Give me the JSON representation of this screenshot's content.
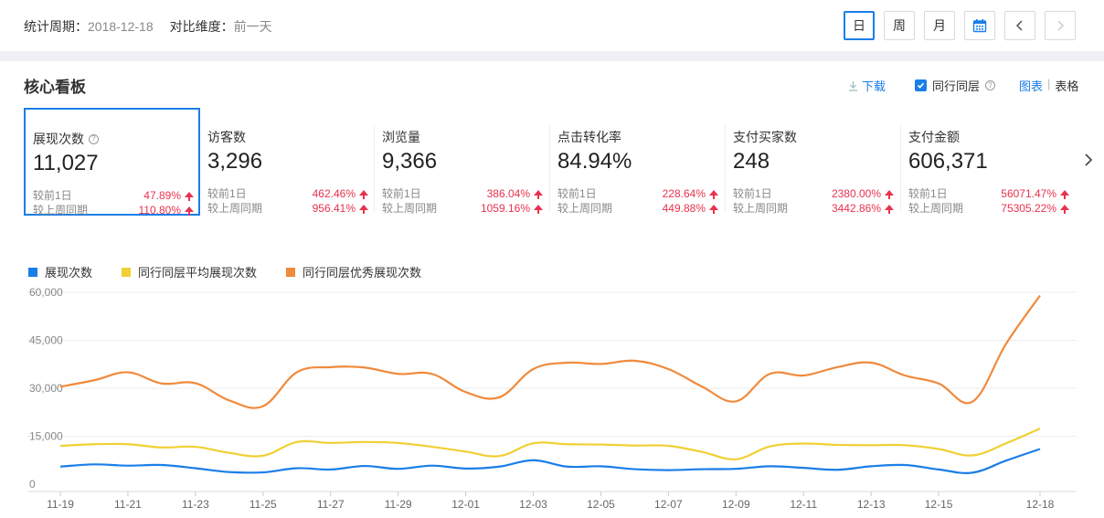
{
  "filters": {
    "period_label": "统计周期：",
    "period_value": "2018-12-18",
    "compare_label": "对比维度：",
    "compare_value": "前一天"
  },
  "range_buttons": [
    "日",
    "周",
    "月"
  ],
  "active_range": "日",
  "section": {
    "title": "核心看板",
    "download_label": "下载",
    "peer_label": "同行同层",
    "view_chart": "图表",
    "view_table": "表格"
  },
  "metrics": [
    {
      "label": "展现次数",
      "value": "11,027",
      "day_label": "较前1日",
      "day_change": "47.89%",
      "week_label": "较上周同期",
      "week_change": "110.80%"
    },
    {
      "label": "访客数",
      "value": "3,296",
      "day_label": "较前1日",
      "day_change": "462.46%",
      "week_label": "较上周同期",
      "week_change": "956.41%"
    },
    {
      "label": "浏览量",
      "value": "9,366",
      "day_label": "较前1日",
      "day_change": "386.04%",
      "week_label": "较上周同期",
      "week_change": "1059.16%"
    },
    {
      "label": "点击转化率",
      "value": "84.94%",
      "day_label": "较前1日",
      "day_change": "228.64%",
      "week_label": "较上周同期",
      "week_change": "449.88%"
    },
    {
      "label": "支付买家数",
      "value": "248",
      "day_label": "较前1日",
      "day_change": "2380.00%",
      "week_label": "较上周同期",
      "week_change": "3442.86%"
    },
    {
      "label": "支付金额",
      "value": "606,371",
      "day_label": "较前1日",
      "day_change": "56071.47%",
      "week_label": "较上周同期",
      "week_change": "75305.22%"
    }
  ],
  "colors": {
    "accent": "#1a7ee8",
    "up": "#e8324e",
    "series_blue": "#1a7ee8",
    "series_yellow": "#f0d034",
    "series_orange": "#f08a3c"
  },
  "chart_data": {
    "type": "line",
    "x": [
      "11-19",
      "11-20",
      "11-21",
      "11-22",
      "11-23",
      "11-24",
      "11-25",
      "11-26",
      "11-27",
      "11-28",
      "11-29",
      "11-30",
      "12-01",
      "12-02",
      "12-03",
      "12-04",
      "12-05",
      "12-06",
      "12-07",
      "12-08",
      "12-09",
      "12-10",
      "12-11",
      "12-12",
      "12-13",
      "12-14",
      "12-15",
      "12-16",
      "12-17",
      "12-18"
    ],
    "x_tick_labels": [
      "11-19",
      "11-21",
      "11-23",
      "11-25",
      "11-27",
      "11-29",
      "12-01",
      "12-03",
      "12-05",
      "12-07",
      "12-09",
      "12-11",
      "12-13",
      "12-15",
      "12-18"
    ],
    "y_tick_labels": [
      "0",
      "15,000",
      "30,000",
      "45,000",
      "60,000"
    ],
    "ylim": [
      0,
      60000
    ],
    "grid": true,
    "legend_position": "top-left",
    "series": [
      {
        "name": "展现次数",
        "color": "#1a7ee8",
        "values": [
          5500,
          6200,
          5800,
          6000,
          5000,
          3800,
          3700,
          5000,
          4600,
          5700,
          4800,
          5800,
          4900,
          5500,
          7500,
          5500,
          5600,
          4700,
          4400,
          4700,
          4800,
          5600,
          5100,
          4500,
          5600,
          6000,
          4600,
          3600,
          7400,
          11000
        ]
      },
      {
        "name": "同行同层平均展现次数",
        "color": "#f0d034",
        "values": [
          12000,
          12500,
          12500,
          11500,
          11700,
          9800,
          8900,
          13200,
          12900,
          13200,
          12900,
          11700,
          10200,
          8800,
          12800,
          12500,
          12400,
          12100,
          12000,
          10100,
          7800,
          11800,
          12700,
          12300,
          12200,
          12200,
          11000,
          9000,
          12800,
          17400
        ]
      },
      {
        "name": "同行同层优秀展现次数",
        "color": "#f08a3c",
        "values": [
          30500,
          32500,
          35000,
          31500,
          31600,
          26200,
          24400,
          35000,
          36600,
          36500,
          34500,
          34500,
          28800,
          27200,
          36000,
          38000,
          37600,
          38600,
          36000,
          30500,
          25900,
          34500,
          34000,
          36600,
          38000,
          34000,
          31500,
          25800,
          44000,
          59000
        ]
      }
    ]
  }
}
